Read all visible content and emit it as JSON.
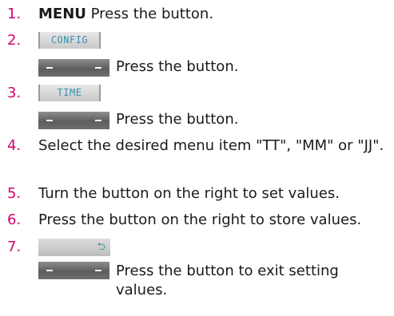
{
  "steps": [
    {
      "num": "1.",
      "bold": "MENU",
      "text": " Press the button."
    },
    {
      "num": "2.",
      "label": "CONFIG",
      "text": "Press the button."
    },
    {
      "num": "3.",
      "label": "TIME",
      "text": "Press the button."
    },
    {
      "num": "4.",
      "text": "Select the desired menu item \"TT\", \"MM\" or \"JJ\"."
    },
    {
      "num": "5.",
      "text": "Turn the button on the right to set values."
    },
    {
      "num": "6.",
      "text": "Press the button on the right to store values."
    },
    {
      "num": "7.",
      "icon": "back-arrow-icon",
      "text": "Press the button to exit setting values."
    }
  ],
  "colors": {
    "step_number": "#d6006e",
    "lcd_text": "#3b8fb0",
    "key_bar": "#6e6e6e"
  }
}
